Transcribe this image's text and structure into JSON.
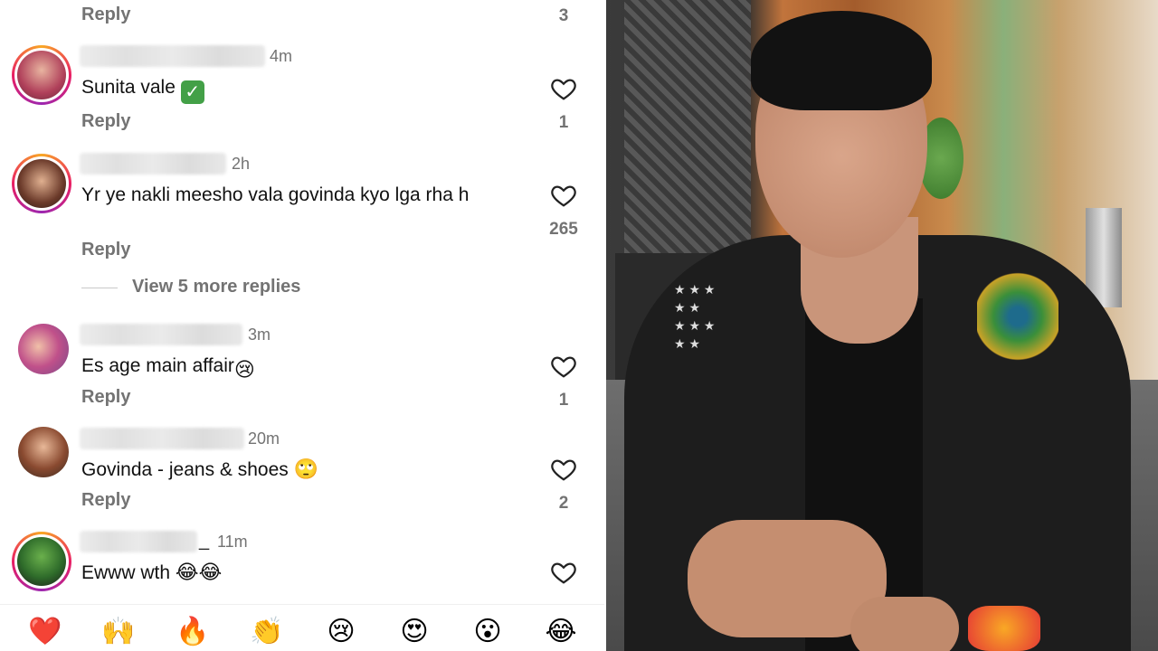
{
  "top": {
    "reply_label": "Reply",
    "like_count": "3"
  },
  "comments": [
    {
      "time": "4m",
      "text": "Sunita vale",
      "emoji": "✅",
      "reply_label": "Reply",
      "likes": "1"
    },
    {
      "time": "2h",
      "text": "Yr ye nakli meesho vala govinda kyo lga rha h",
      "reply_label": "Reply",
      "likes": "265"
    },
    {
      "time": "3m",
      "text": "Es age main affair",
      "emoji": "😢",
      "reply_label": "Reply",
      "likes": "1"
    },
    {
      "time": "20m",
      "text": "Govinda - jeans & shoes",
      "emoji": "🙄",
      "reply_label": "Reply",
      "likes": "2"
    },
    {
      "username_suffix": "_",
      "time": "11m",
      "text": "Ewww wth",
      "emoji": "😂😂"
    }
  ],
  "view_more": "View 5 more replies",
  "emoji_bar": [
    "❤️",
    "🙌",
    "🔥",
    "👏",
    "😢",
    "😍",
    "😮",
    "😂"
  ],
  "video": {
    "stars": "★ ★ ★\n★ ★\n★ ★ ★\n★ ★"
  },
  "icons": {
    "like": "heart-outline-icon"
  }
}
